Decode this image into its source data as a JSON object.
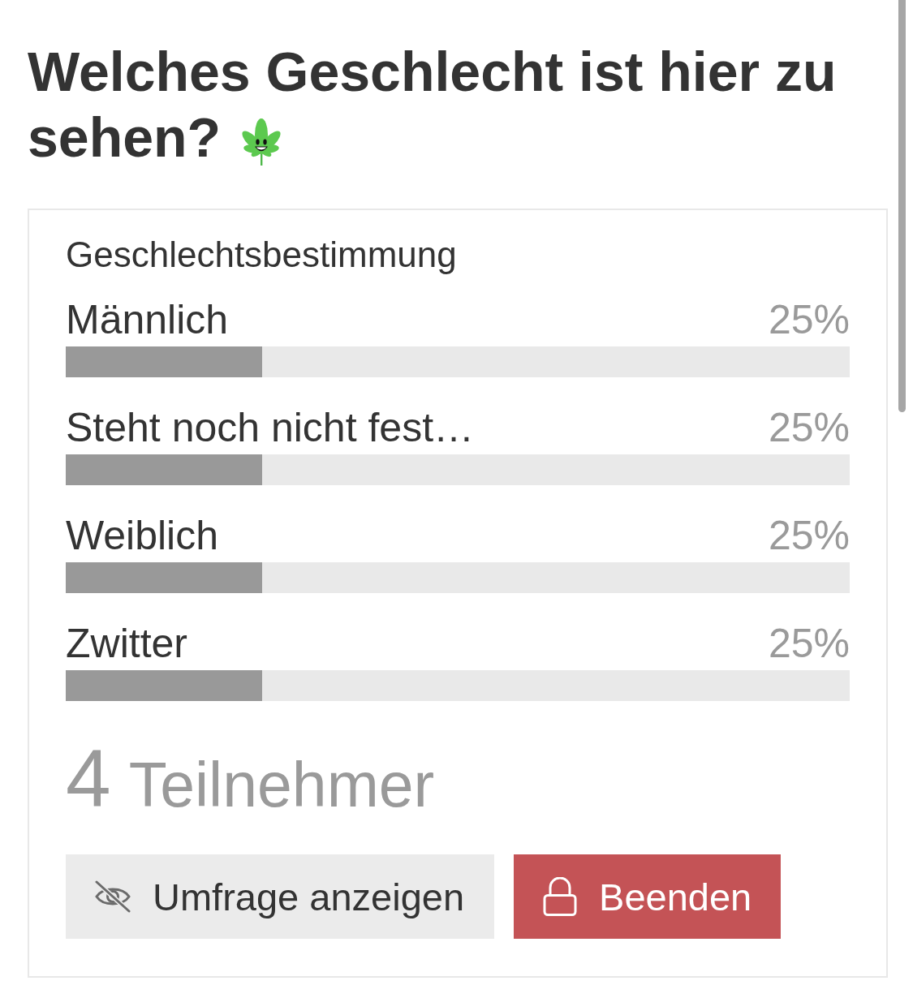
{
  "question": {
    "title_lines": [
      "Welches Geschlecht ist hier zu",
      "sehen?"
    ]
  },
  "poll": {
    "heading": "Geschlechtsbestimmung",
    "options": [
      {
        "label": "Männlich",
        "percent": "25%",
        "level": 0.25
      },
      {
        "label": "Steht noch nicht fest…",
        "percent": "25%",
        "level": 0.25
      },
      {
        "label": "Weiblich",
        "percent": "25%",
        "level": 0.25
      },
      {
        "label": "Zwitter",
        "percent": "25%",
        "level": 0.25
      }
    ],
    "participants": {
      "count": "4",
      "label": "Teilnehmer"
    },
    "buttons": [
      {
        "kind": "secondary",
        "label": "Umfrage anzeigen"
      },
      {
        "kind": "danger",
        "label": "Beenden"
      }
    ]
  }
}
